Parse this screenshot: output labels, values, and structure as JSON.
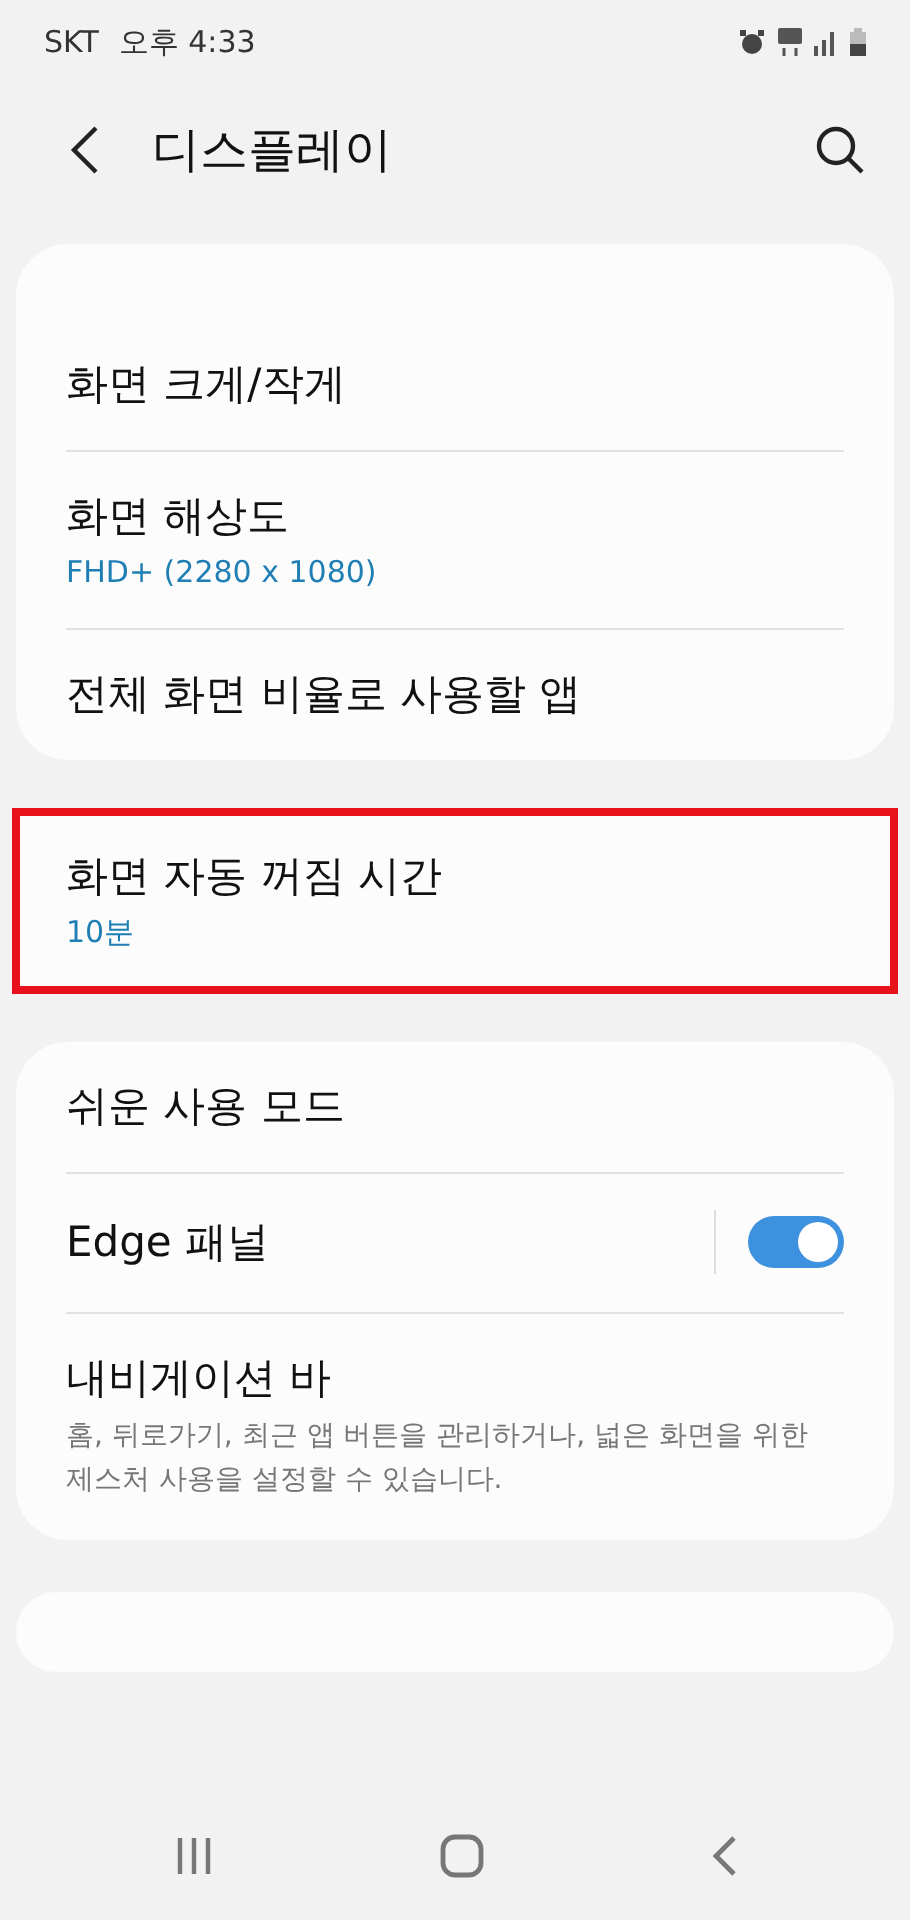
{
  "status_bar": {
    "carrier": "SKT",
    "time": "오후 4:33"
  },
  "header": {
    "title": "디스플레이"
  },
  "groups": [
    {
      "kind": "clipped_top",
      "items": [
        {
          "title": "화면 크게/작게"
        },
        {
          "title": "화면 해상도",
          "subtitle": "FHD+ (2280 x 1080)"
        },
        {
          "title": "전체 화면 비율로 사용할 앱"
        }
      ]
    },
    {
      "kind": "card",
      "highlighted": true,
      "items": [
        {
          "title": "화면 자동 꺼짐 시간",
          "subtitle": "10분"
        }
      ]
    },
    {
      "kind": "card",
      "items": [
        {
          "title": "쉬운 사용 모드"
        },
        {
          "title": "Edge 패널",
          "kind": "switch",
          "on": true
        },
        {
          "title": "내비게이션 바",
          "description": "홈, 뒤로가기, 최근 앱 버튼을 관리하거나, 넓은 화면을 위한 제스처 사용을 설정할 수 있습니다."
        }
      ]
    },
    {
      "kind": "clipped_bottom"
    }
  ]
}
